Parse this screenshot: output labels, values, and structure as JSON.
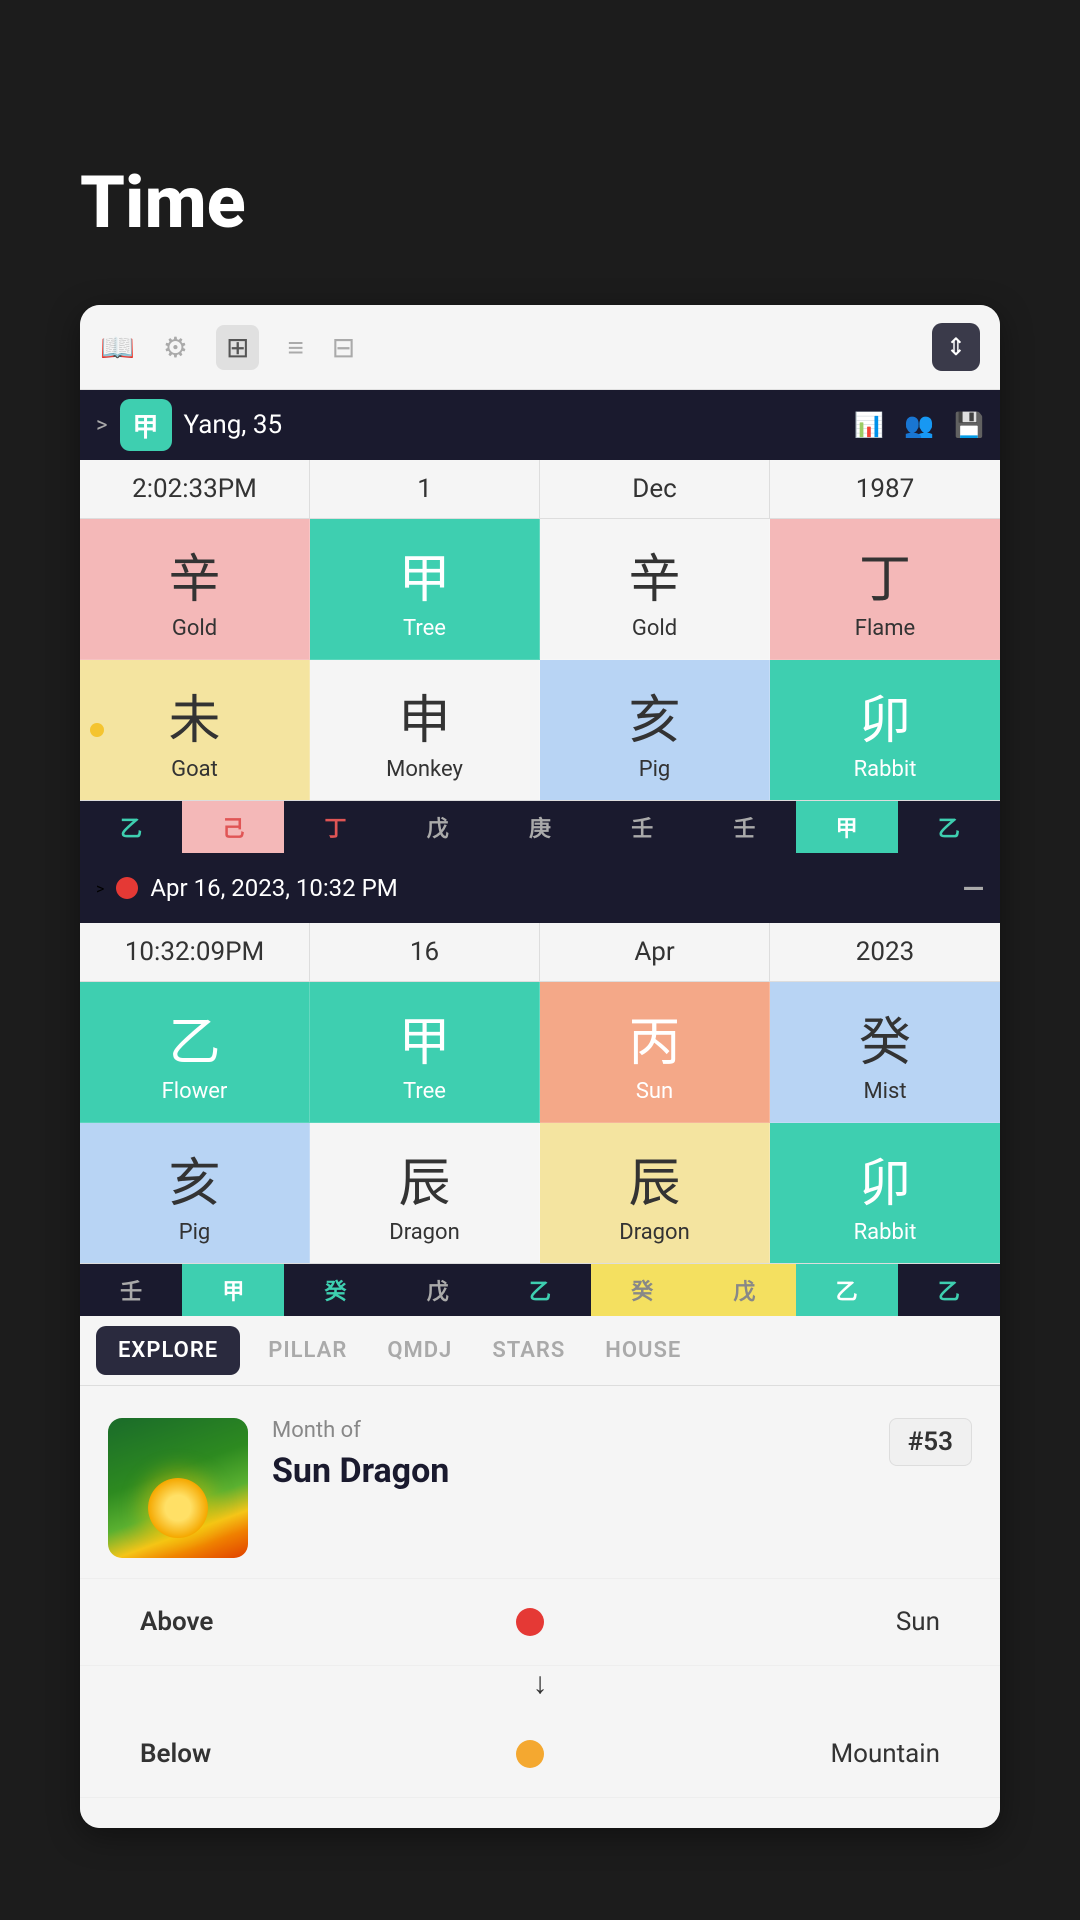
{
  "page": {
    "title": "Time"
  },
  "toolbar": {
    "book_icon": "📖",
    "gear_icon": "⚙",
    "grid_icon": "⊞",
    "menu_icon": "≡",
    "table_icon": "⊟",
    "height_icon": "⇕"
  },
  "section1": {
    "chevron": ">",
    "symbol": "甲",
    "label": "Yang, 35",
    "bar_icon": "📊",
    "people_icon": "👥",
    "save_icon": "💾"
  },
  "row1": {
    "time": "2:02:33PM",
    "day": "1",
    "month": "Dec",
    "year": "1987"
  },
  "stems1": [
    {
      "chinese": "辛",
      "english": "Gold",
      "color": "pink"
    },
    {
      "chinese": "甲",
      "english": "Tree",
      "color": "teal"
    },
    {
      "chinese": "辛",
      "english": "Gold",
      "color": "white"
    },
    {
      "chinese": "丁",
      "english": "Flame",
      "color": "pink"
    }
  ],
  "branches1": [
    {
      "chinese": "未",
      "english": "Goat",
      "color": "yellow",
      "dot": true
    },
    {
      "chinese": "申",
      "english": "Monkey",
      "color": "white"
    },
    {
      "chinese": "亥",
      "english": "Pig",
      "color": "blue"
    },
    {
      "chinese": "卯",
      "english": "Rabbit",
      "color": "teal"
    }
  ],
  "small_stems1": [
    {
      "char": "乙",
      "style": "green"
    },
    {
      "char": "己",
      "style": "pink"
    },
    {
      "char": "丁",
      "style": "red"
    },
    {
      "char": "戊",
      "style": "gray"
    },
    {
      "char": "庚",
      "style": "gray"
    },
    {
      "char": "壬",
      "style": "gray"
    },
    {
      "char": "壬",
      "style": "gray"
    },
    {
      "char": "甲",
      "style": "teal-bg"
    },
    {
      "char": "乙",
      "style": "teal-text"
    }
  ],
  "section2": {
    "chevron": ">",
    "date_label": "Apr 16, 2023, 10:32 PM",
    "dash": "—"
  },
  "row2": {
    "time": "10:32:09PM",
    "day": "16",
    "month": "Apr",
    "year": "2023"
  },
  "stems2": [
    {
      "chinese": "乙",
      "english": "Flower",
      "color": "teal"
    },
    {
      "chinese": "甲",
      "english": "Tree",
      "color": "teal"
    },
    {
      "chinese": "丙",
      "english": "Sun",
      "color": "salmon"
    },
    {
      "chinese": "癸",
      "english": "Mist",
      "color": "blue"
    }
  ],
  "branches2": [
    {
      "chinese": "亥",
      "english": "Pig",
      "color": "blue"
    },
    {
      "chinese": "辰",
      "english": "Dragon",
      "color": "white"
    },
    {
      "chinese": "辰",
      "english": "Dragon",
      "color": "yellow"
    },
    {
      "chinese": "卯",
      "english": "Rabbit",
      "color": "teal"
    }
  ],
  "small_stems2": [
    {
      "char": "壬",
      "style": "gray"
    },
    {
      "char": "甲",
      "style": "teal-bg"
    },
    {
      "char": "癸",
      "style": "teal-text"
    },
    {
      "char": "戊",
      "style": "gray"
    },
    {
      "char": "乙",
      "style": "green"
    },
    {
      "char": "癸",
      "style": "yellow-bg"
    },
    {
      "char": "戊",
      "style": "yellow-bg"
    },
    {
      "char": "乙",
      "style": "teal-bg"
    },
    {
      "char": "乙",
      "style": "teal-text"
    }
  ],
  "tabs": [
    {
      "label": "EXPLORE",
      "active": true
    },
    {
      "label": "PILLAR",
      "active": false
    },
    {
      "label": "QMDJ",
      "active": false
    },
    {
      "label": "STARS",
      "active": false
    },
    {
      "label": "HOUSE",
      "active": false
    }
  ],
  "explore": {
    "subtitle": "Month of",
    "title": "Sun Dragon",
    "badge": "#53",
    "above_label": "Above",
    "above_value": "Sun",
    "below_label": "Below",
    "below_value": "Mountain",
    "arrow": "↓"
  }
}
